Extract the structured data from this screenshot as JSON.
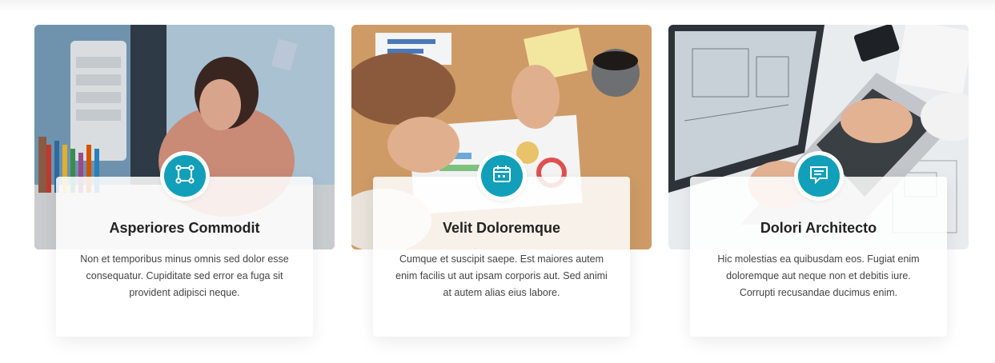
{
  "colors": {
    "accent": "#119fb9",
    "title": "#222222",
    "text": "#444444"
  },
  "cards": [
    {
      "title": "Asperiores Commodit",
      "text": "Non et temporibus minus omnis sed dolor esse consequatur. Cupiditate sed error ea fuga sit provident adipisci neque.",
      "icon": "bounding-box-icon",
      "image": "woman-drawing-photo"
    },
    {
      "title": "Velit Doloremque",
      "text": "Cumque et suscipit saepe. Est maiores autem enim facilis ut aut ipsam corporis aut. Sed animi at autem alias eius labore.",
      "icon": "calendar-icon",
      "image": "team-meeting-photo"
    },
    {
      "title": "Dolori Architecto",
      "text": "Hic molestias ea quibusdam eos. Fugiat enim doloremque aut neque non et debitis iure. Corrupti recusandae ducimus enim.",
      "icon": "chat-icon",
      "image": "laptop-blueprint-photo"
    }
  ]
}
